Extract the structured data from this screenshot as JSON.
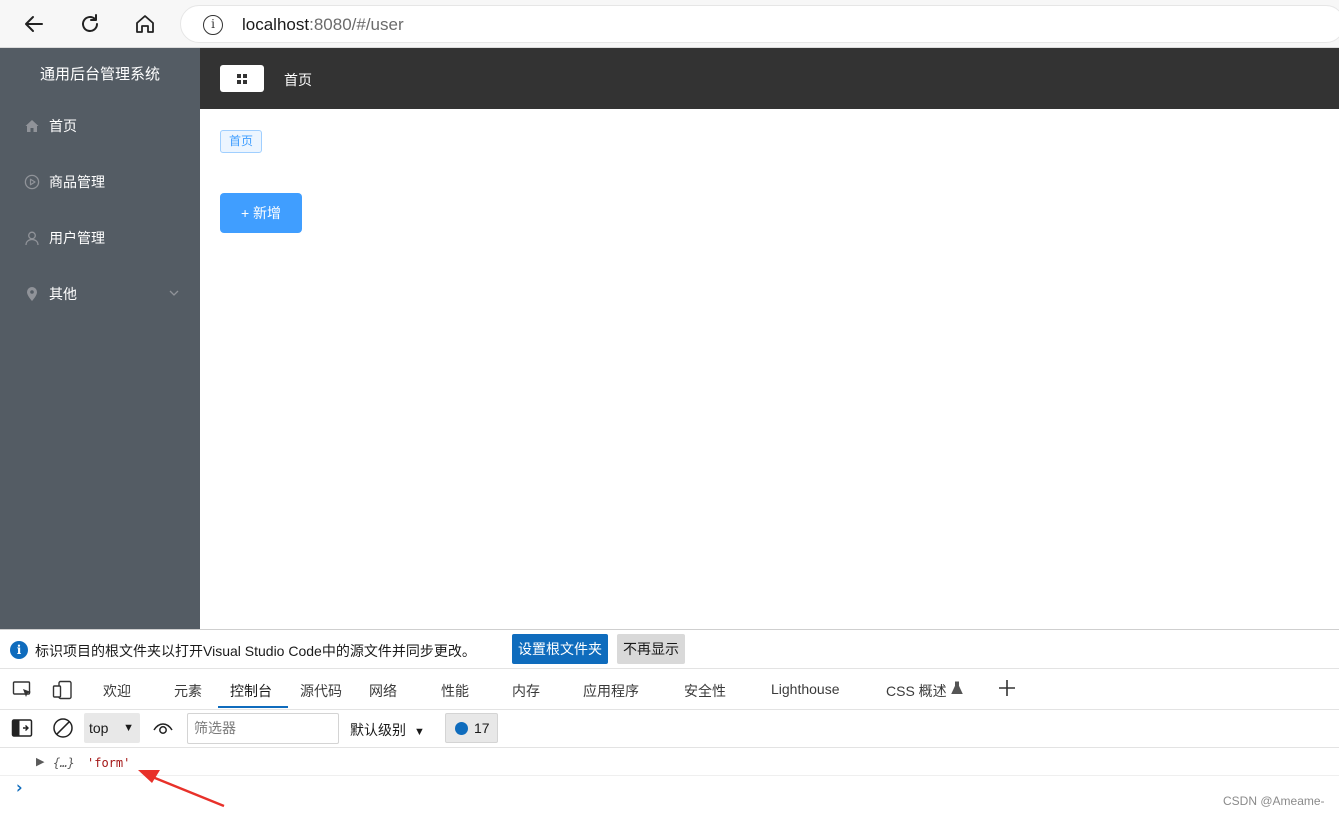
{
  "browser": {
    "url_host": "localhost",
    "url_rest": ":8080/#/user"
  },
  "app": {
    "title": "通用后台管理系统",
    "header_title": "首页",
    "menu": [
      {
        "label": "首页",
        "icon": "house-icon"
      },
      {
        "label": "商品管理",
        "icon": "play-circle-icon"
      },
      {
        "label": "用户管理",
        "icon": "user-icon"
      },
      {
        "label": "其他",
        "icon": "location-icon"
      }
    ],
    "tag_label": "首页",
    "add_button_label": "+ 新增"
  },
  "devtools": {
    "info_text": "标识项目的根文件夹以打开Visual Studio Code中的源文件并同步更改。",
    "set_root_label": "设置根文件夹",
    "dont_show_label": "不再显示",
    "tabs": [
      "欢迎",
      "元素",
      "控制台",
      "源代码",
      "网络",
      "性能",
      "内存",
      "应用程序",
      "安全性",
      "Lighthouse",
      "CSS 概述"
    ],
    "context": "top",
    "filter_placeholder": "筛选器",
    "level": "默认级别",
    "message_count": "17",
    "console_object": "{…}",
    "console_string": "'form'"
  },
  "watermark": "CSDN @Ameame-",
  "colors": {
    "sidebar_bg": "#545c64",
    "header_bg": "#333333",
    "primary": "#409eff",
    "devtools_accent": "#0f6cbd"
  }
}
